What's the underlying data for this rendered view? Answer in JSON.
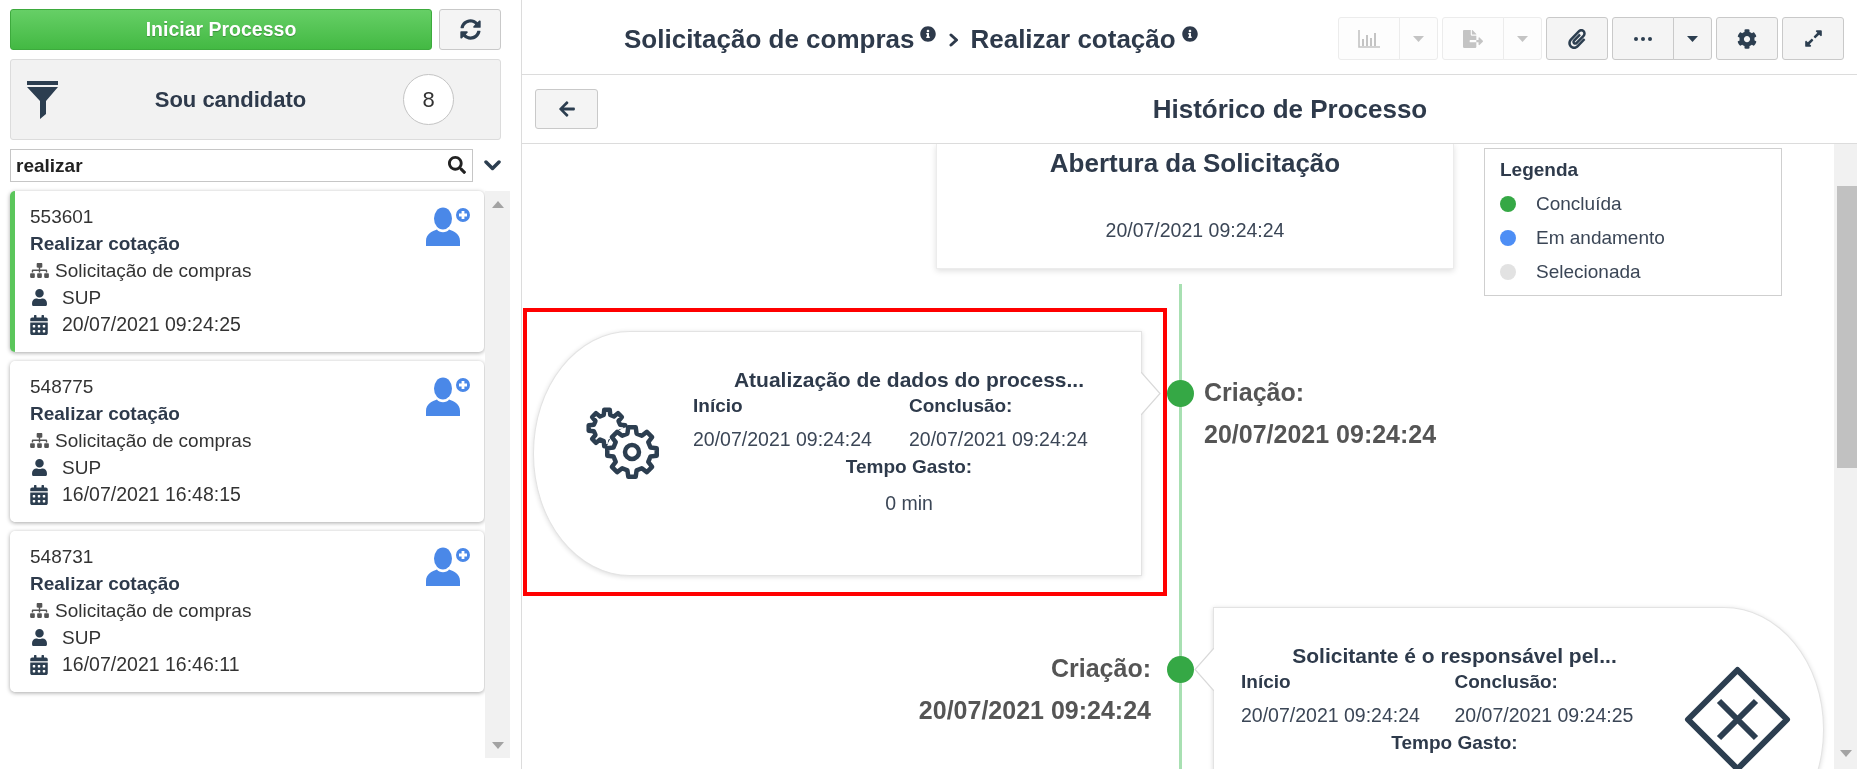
{
  "sidebar": {
    "start_button": "Iniciar Processo",
    "filter": {
      "label": "Sou candidato",
      "count": "8"
    },
    "search": {
      "value": "realizar"
    },
    "tasks": [
      {
        "number": "553601",
        "title": "Realizar cotação",
        "process": "Solicitação de compras",
        "user": "SUP",
        "date": "20/07/2021 09:24:25",
        "selected": true
      },
      {
        "number": "548775",
        "title": "Realizar cotação",
        "process": "Solicitação de compras",
        "user": "SUP",
        "date": "16/07/2021 16:48:15",
        "selected": false
      },
      {
        "number": "548731",
        "title": "Realizar cotação",
        "process": "Solicitação de compras",
        "user": "SUP",
        "date": "16/07/2021 16:46:11",
        "selected": false
      }
    ]
  },
  "header": {
    "breadcrumb": [
      {
        "label": "Solicitação de compras"
      },
      {
        "label": "Realizar cotação"
      }
    ],
    "toolbar": [
      {
        "kind": "chart",
        "disabled": true,
        "menu": true
      },
      {
        "kind": "export",
        "disabled": true,
        "menu": true
      },
      {
        "kind": "attach",
        "disabled": false,
        "menu": false
      },
      {
        "kind": "more",
        "disabled": false,
        "menu": true
      },
      {
        "kind": "settings",
        "disabled": false,
        "menu": false
      },
      {
        "kind": "expand",
        "disabled": false,
        "menu": false
      }
    ]
  },
  "history": {
    "title": "Histórico de Processo",
    "start": {
      "title": "Abertura da Solicitação",
      "date": "20/07/2021 09:24:24"
    },
    "legend": {
      "title": "Legenda",
      "items": [
        {
          "label": "Concluída",
          "color": "#35a845"
        },
        {
          "label": "Em andamento",
          "color": "#4d8ef5"
        },
        {
          "label": "Selecionada",
          "color": "#e2e2e2"
        }
      ]
    },
    "events": [
      {
        "card_on_right": false,
        "kind": "service",
        "highlighted": true,
        "color": "#35a845",
        "title": "Atualização de dados do process...",
        "start_label": "Início",
        "start": "20/07/2021 09:24:24",
        "end_label": "Conclusão:",
        "end": "20/07/2021 09:24:24",
        "duration_label": "Tempo Gasto:",
        "duration": "0 min",
        "created_label": "Criação:",
        "created": "20/07/2021 09:24:24"
      },
      {
        "card_on_right": true,
        "kind": "gateway",
        "highlighted": false,
        "color": "#35a845",
        "title": "Solicitante é o responsável pel...",
        "start_label": "Início",
        "start": "20/07/2021 09:24:24",
        "end_label": "Conclusão:",
        "end": "20/07/2021 09:24:25",
        "duration_label": "Tempo Gasto:",
        "created_label": "Criação:",
        "created": "20/07/2021 09:24:24"
      }
    ]
  }
}
